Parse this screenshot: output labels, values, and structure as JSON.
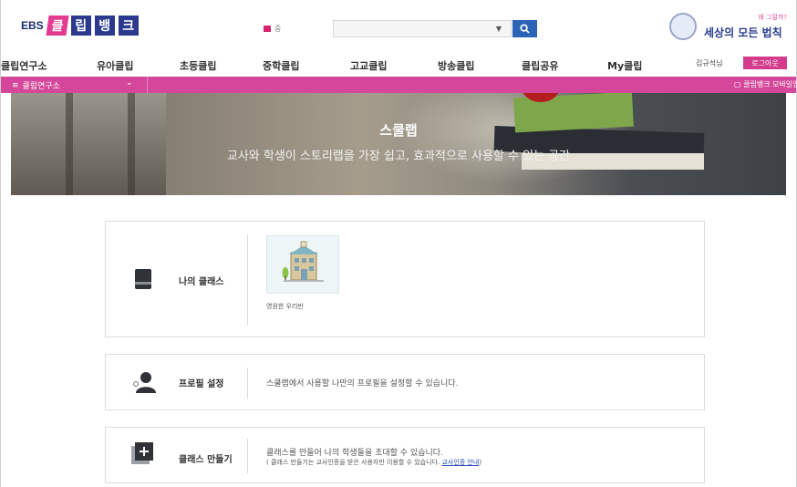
{
  "header": {
    "logo_prefix": "EBS",
    "logo_chars": [
      "클",
      "립",
      "뱅",
      "크"
    ],
    "lang_label": "중",
    "search_placeholder": "",
    "promo_small": "왜 그럴까?",
    "promo_big": "세상의 모든 법칙"
  },
  "nav": {
    "items": [
      "클립연구소",
      "유아클립",
      "초등클립",
      "중학클립",
      "고교클립",
      "방송클립",
      "클립공유",
      "My클립"
    ],
    "user_label": "김규석님",
    "logout_label": "로그아웃"
  },
  "subbar": {
    "menu_label": "클립연구소",
    "mobile_label": "클립뱅크 모바일앱"
  },
  "hero": {
    "title": "스쿨랩",
    "subtitle": "교사와 학생이 스토리랩을 가장 쉽고, 효과적으로 사용할 수 있는 공간"
  },
  "cards": {
    "my_class": {
      "label": "나의 클래스",
      "class_name": "영원한 우리반"
    },
    "profile": {
      "label": "프로필 설정",
      "desc": "스쿨랩에서 사용할 나만의 프로필을 설정할 수 있습니다."
    },
    "create": {
      "label": "클래스 만들기",
      "desc": "클래스를 만들어 나의 학생들을 초대할 수 있습니다.",
      "note": "( 클래스 만들기는 교사인증을 받은 사용자만 이용할 수 있습니다.",
      "note_link": "교사인증 안내",
      "note_end": ")"
    }
  },
  "colors": {
    "brand_pink": "#d4479a",
    "brand_blue": "#2b3a8f",
    "search_blue": "#2b64b6"
  }
}
